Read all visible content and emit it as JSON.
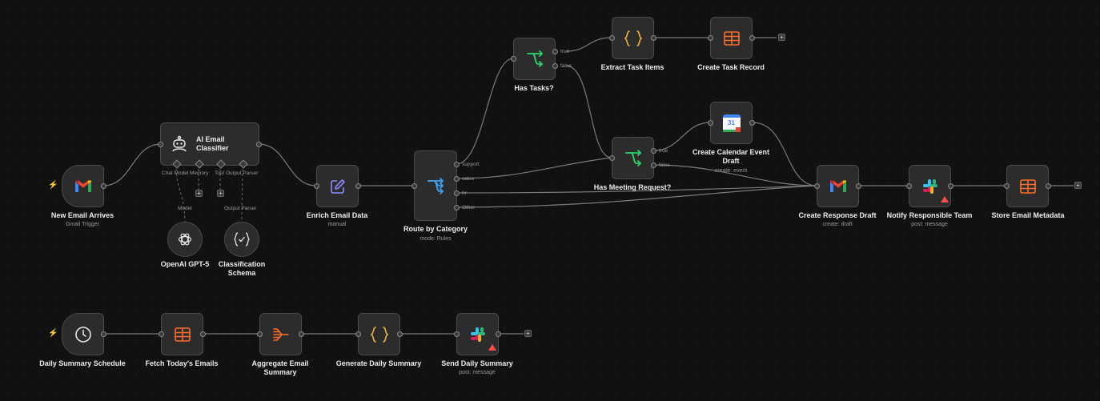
{
  "colors": {
    "canvas": "#111111",
    "node": "#2c2c2c",
    "edge": "#7a7a7a",
    "router": "#2ad46b",
    "table": "#ff6d2d",
    "code": "#f3b33c",
    "edit": "#8b8bff",
    "bolt": "#ff6d2d",
    "warning": "#ff4d4d"
  },
  "nodes": {
    "new_email": {
      "title": "New Email Arrives",
      "subtitle": "Gmail Trigger",
      "icon": "gmail-icon"
    },
    "ai_classifier": {
      "title_line1": "AI Email",
      "title_line2": "Classifier",
      "icon": "robot-icon",
      "ports": [
        "Chat Model",
        "Memory",
        "Tool",
        "Output Parser"
      ]
    },
    "openai": {
      "title": "OpenAI GPT-5",
      "port_label": "Model",
      "icon": "openai-icon"
    },
    "schema": {
      "title_line1": "Classification",
      "title_line2": "Schema",
      "port_label": "Output Parser",
      "icon": "schema-icon"
    },
    "enrich": {
      "title": "Enrich Email Data",
      "subtitle": "manual",
      "icon": "pencil-icon"
    },
    "route": {
      "title": "Route by Category",
      "subtitle": "mode: Rules",
      "icon": "router-icon",
      "outputs": [
        "support",
        "sales",
        "hr",
        "Other"
      ]
    },
    "has_tasks": {
      "title": "Has Tasks?",
      "icon": "if-icon",
      "outputs": [
        "true",
        "false"
      ]
    },
    "extract_tasks": {
      "title": "Extract Task Items",
      "icon": "code-icon"
    },
    "create_task": {
      "title": "Create Task Record",
      "icon": "table-icon"
    },
    "has_meeting": {
      "title": "Has Meeting Request?",
      "icon": "if-icon",
      "outputs": [
        "true",
        "false"
      ]
    },
    "calendar": {
      "title_line1": "Create Calendar Event",
      "title_line2": "Draft",
      "subtitle": "create: event",
      "icon": "google-calendar-icon",
      "calendar_day": "31"
    },
    "response_draft": {
      "title": "Create Response Draft",
      "subtitle": "create: draft",
      "icon": "gmail-icon"
    },
    "notify_team": {
      "title": "Notify Responsible Team",
      "subtitle": "post: message",
      "icon": "slack-icon"
    },
    "store_metadata": {
      "title": "Store Email Metadata",
      "icon": "table-icon"
    },
    "daily_schedule": {
      "title": "Daily Summary Schedule",
      "icon": "clock-icon"
    },
    "fetch_emails": {
      "title": "Fetch Today's Emails",
      "icon": "table-icon"
    },
    "aggregate": {
      "title_line1": "Aggregate Email",
      "title_line2": "Summary",
      "icon": "aggregate-icon"
    },
    "generate_summary": {
      "title": "Generate Daily Summary",
      "icon": "code-icon"
    },
    "send_summary": {
      "title": "Send Daily Summary",
      "subtitle": "post: message",
      "icon": "slack-icon"
    }
  }
}
